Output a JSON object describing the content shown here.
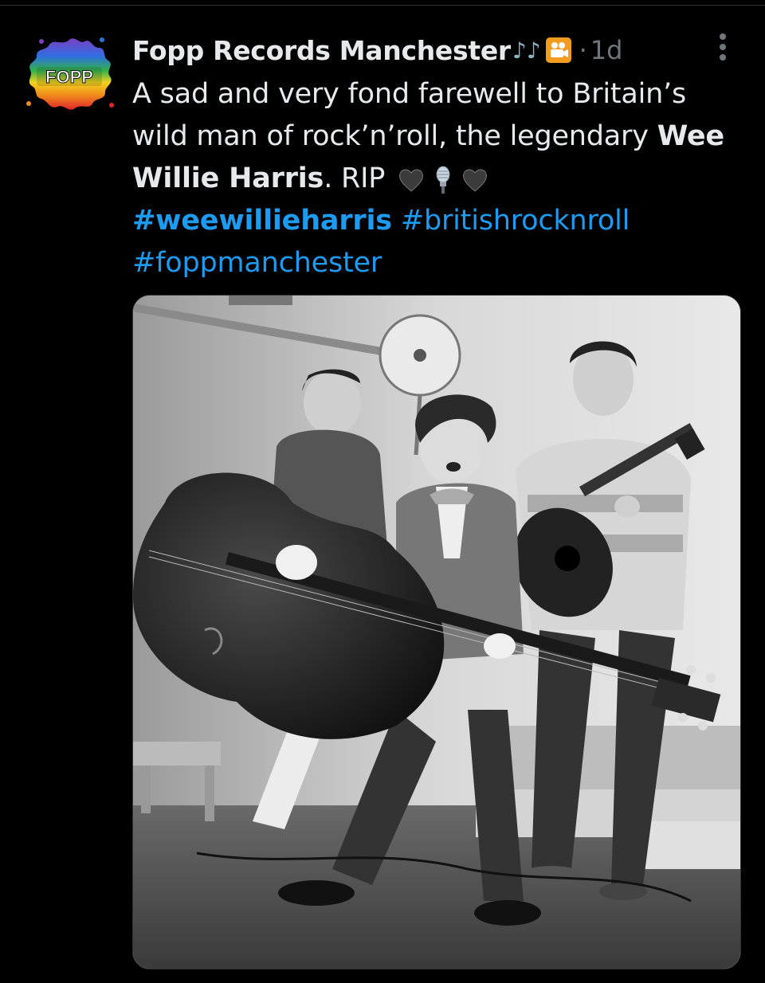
{
  "post": {
    "author_name": "Fopp Records Manchester",
    "author_emoji": "♪♪",
    "camera_icon": "movie-camera-icon",
    "separator": "·",
    "timestamp": "1d",
    "avatar_logo_text": "FOPP",
    "text_line1": "A sad and very fond farewell to Britain’s",
    "text_line2_a": "wild man of rock’n’roll, the legendary ",
    "text_line2_bold": "Wee",
    "text_line3_bold": "Willie Harris",
    "text_line3_b": ". RIP ",
    "emojis": [
      "black-heart-icon",
      "microphone-icon",
      "black-heart-icon"
    ],
    "hashtags": [
      "#weewillieharris",
      "#britishrocknroll",
      "#foppmanchester"
    ]
  },
  "colors": {
    "background": "#000000",
    "text": "#e7e9ea",
    "muted": "#71767b",
    "link": "#1d9bf0"
  }
}
